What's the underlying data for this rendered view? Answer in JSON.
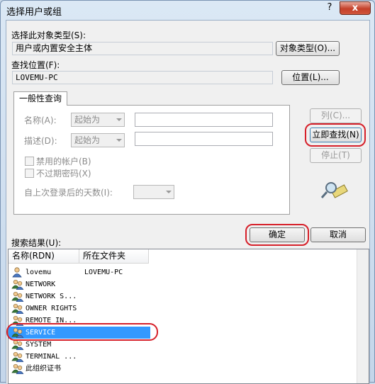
{
  "window": {
    "title": "选择用户或组",
    "help": "?",
    "close": "x"
  },
  "object_type": {
    "label": "选择此对象类型(S):",
    "value": "用户或内置安全主体",
    "button": "对象类型(O)..."
  },
  "location": {
    "label": "查找位置(F):",
    "value": "LOVEMU-PC",
    "button": "位置(L)..."
  },
  "query_tab": {
    "tab_label": "一般性查询",
    "name_label": "名称(A):",
    "name_mode": "起始为",
    "desc_label": "描述(D):",
    "desc_mode": "起始为",
    "disabled_accounts": "禁用的帐户(B)",
    "non_expiring_password": "不过期密码(X)",
    "days_since_logon": "自上次登录后的天数(I):"
  },
  "side_buttons": {
    "columns": "列(C)...",
    "find_now": "立即查找(N)",
    "stop": "停止(T)"
  },
  "dialog_buttons": {
    "ok": "确定",
    "cancel": "取消"
  },
  "results": {
    "label": "搜索结果(U):",
    "columns": [
      "名称(RDN)",
      "所在文件夹"
    ],
    "rows": [
      {
        "name": "lovemu",
        "folder": "LOVEMU-PC",
        "icon": "user-icon"
      },
      {
        "name": "NETWORK",
        "folder": "",
        "icon": "group-icon"
      },
      {
        "name": "NETWORK S...",
        "folder": "",
        "icon": "group-icon"
      },
      {
        "name": "OWNER RIGHTS",
        "folder": "",
        "icon": "group-icon"
      },
      {
        "name": "REMOTE IN...",
        "folder": "",
        "icon": "group-icon"
      },
      {
        "name": "SERVICE",
        "folder": "",
        "icon": "group-icon",
        "selected": true
      },
      {
        "name": "SYSTEM",
        "folder": "",
        "icon": "group-icon"
      },
      {
        "name": "TERMINAL ...",
        "folder": "",
        "icon": "group-icon"
      },
      {
        "name": "此组织证书",
        "folder": "",
        "icon": "group-icon"
      }
    ]
  },
  "colors": {
    "highlight": "#d6202a",
    "selection": "#3399ff"
  }
}
